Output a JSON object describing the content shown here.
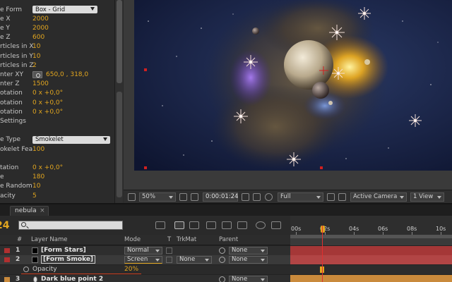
{
  "effect_controls": {
    "rows": [
      {
        "label": "e Form",
        "type": "select",
        "value": "Box - Grid"
      },
      {
        "label": "e X",
        "type": "value",
        "value": "2000"
      },
      {
        "label": "e Y",
        "type": "value",
        "value": "2000"
      },
      {
        "label": "e Z",
        "type": "value",
        "value": "600"
      },
      {
        "label": "rticles in X",
        "type": "value",
        "value": "10"
      },
      {
        "label": "rticles in Y",
        "type": "value",
        "value": "10"
      },
      {
        "label": "rticles in Z",
        "type": "value",
        "value": "2"
      },
      {
        "label": "nter XY",
        "type": "point",
        "value": "650,0 , 318,0"
      },
      {
        "label": "nter Z",
        "type": "value",
        "value": "1500"
      },
      {
        "label": "otation",
        "type": "value",
        "value": "0 x +0,0°"
      },
      {
        "label": "otation",
        "type": "value",
        "value": "0 x +0,0°"
      },
      {
        "label": "otation",
        "type": "value",
        "value": "0 x +0,0°"
      },
      {
        "label": "Settings",
        "type": "label",
        "value": ""
      },
      {
        "label": "",
        "type": "label",
        "value": ""
      },
      {
        "label": "e Type",
        "type": "select",
        "value": "Smokelet"
      },
      {
        "label": "okelet Fea",
        "type": "value",
        "value": "100"
      },
      {
        "label": "",
        "type": "label",
        "value": ""
      },
      {
        "label": "tation",
        "type": "value",
        "value": "0 x +0,0°"
      },
      {
        "label": "e",
        "type": "value",
        "value": "180"
      },
      {
        "label": "e Random",
        "type": "value",
        "value": "10"
      },
      {
        "label": "acity",
        "type": "value",
        "value": "5"
      }
    ]
  },
  "viewer_toolbar": {
    "zoom": "50%",
    "timecode": "0:00:01:24",
    "resolution": "Full",
    "camera": "Active Camera",
    "view": "1 View"
  },
  "timeline": {
    "tab_label": "nebula",
    "current_time": "24",
    "columns": {
      "layer_name": "Layer Name",
      "hash": "#",
      "mode": "Mode",
      "t": "T",
      "trkmat": "TrkMat",
      "parent": "Parent"
    },
    "ruler": [
      "00s",
      "02s",
      "04s",
      "06s",
      "08s",
      "10s"
    ],
    "layers": [
      {
        "num": "1",
        "name": "[Form Stars]",
        "mode": "Normal",
        "trkmat": "",
        "parent": "None"
      },
      {
        "num": "2",
        "name": "[Form Smoke]",
        "mode": "Screen",
        "trkmat": "None",
        "parent": "None"
      },
      {
        "num": "3",
        "name": "Dark blue point 2",
        "mode": "",
        "trkmat": "",
        "parent": "None"
      }
    ],
    "property": {
      "name": "Opacity",
      "value": "20%"
    }
  },
  "colors": {
    "accent": "#e2a61f",
    "layer_label_red": "#b03030",
    "bar_red": "#a53737",
    "bar_orange": "#c98a3c"
  }
}
